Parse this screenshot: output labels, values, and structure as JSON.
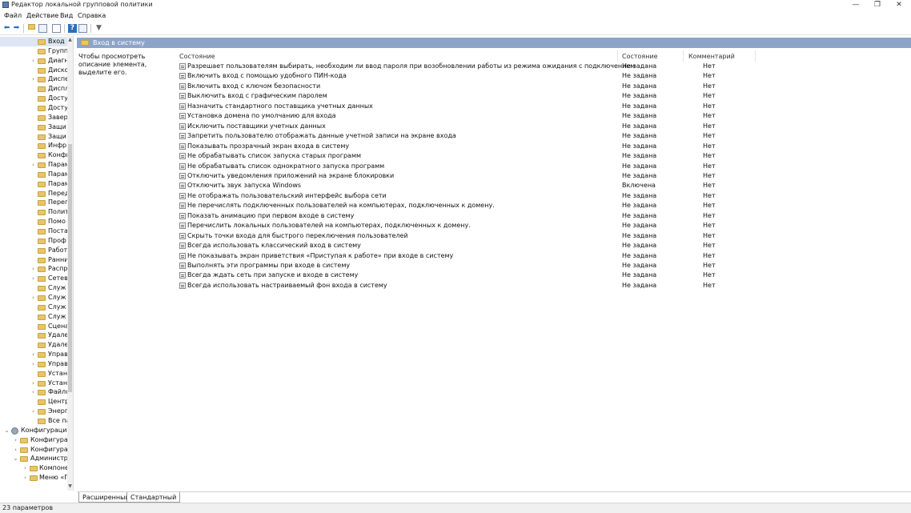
{
  "window": {
    "title": "Редактор локальной групповой политики",
    "controls": {
      "minimize": "—",
      "maximize": "❐",
      "close": "✕"
    }
  },
  "menu": [
    "Файл",
    "Действие",
    "Вид",
    "Справка"
  ],
  "tree": {
    "items": [
      {
        "label": "Вход в",
        "icon": "folder-icon",
        "selected": true
      },
      {
        "label": "Групп",
        "icon": "folder-icon"
      },
      {
        "label": "Диагн",
        "icon": "folder-icon",
        "expandable": true
      },
      {
        "label": "Диско",
        "icon": "folder-icon"
      },
      {
        "label": "Диспе",
        "icon": "folder-icon",
        "expandable": true
      },
      {
        "label": "Диспл",
        "icon": "folder-icon"
      },
      {
        "label": "Досту",
        "icon": "folder-icon"
      },
      {
        "label": "Досту",
        "icon": "folder-icon"
      },
      {
        "label": "Завер",
        "icon": "folder-icon"
      },
      {
        "label": "Защи",
        "icon": "folder-icon"
      },
      {
        "label": "Защи",
        "icon": "folder-icon"
      },
      {
        "label": "Инфр",
        "icon": "folder-icon"
      },
      {
        "label": "Конфи",
        "icon": "folder-icon"
      },
      {
        "label": "Парам",
        "icon": "folder-icon",
        "expandable": true
      },
      {
        "label": "Парам",
        "icon": "folder-icon"
      },
      {
        "label": "Парам",
        "icon": "folder-icon"
      },
      {
        "label": "Перед",
        "icon": "folder-icon"
      },
      {
        "label": "Переп",
        "icon": "folder-icon"
      },
      {
        "label": "Полит",
        "icon": "folder-icon"
      },
      {
        "label": "Помо",
        "icon": "folder-icon"
      },
      {
        "label": "Поста",
        "icon": "folder-icon"
      },
      {
        "label": "Проф",
        "icon": "folder-icon"
      },
      {
        "label": "Работ",
        "icon": "folder-icon"
      },
      {
        "label": "Ранни",
        "icon": "folder-icon"
      },
      {
        "label": "Распр",
        "icon": "folder-icon",
        "expandable": true
      },
      {
        "label": "Сетев",
        "icon": "folder-icon",
        "expandable": true
      },
      {
        "label": "Служ",
        "icon": "folder-icon"
      },
      {
        "label": "Служ",
        "icon": "folder-icon",
        "expandable": true
      },
      {
        "label": "Служ",
        "icon": "folder-icon"
      },
      {
        "label": "Служ",
        "icon": "folder-icon"
      },
      {
        "label": "Сцена",
        "icon": "folder-icon"
      },
      {
        "label": "Удале",
        "icon": "folder-icon"
      },
      {
        "label": "Удале",
        "icon": "folder-icon"
      },
      {
        "label": "Управ",
        "icon": "folder-icon",
        "expandable": true
      },
      {
        "label": "Управ",
        "icon": "folder-icon",
        "expandable": true
      },
      {
        "label": "Устан",
        "icon": "folder-icon"
      },
      {
        "label": "Устан",
        "icon": "folder-icon",
        "expandable": true
      },
      {
        "label": "Файлс",
        "icon": "folder-icon",
        "expandable": true
      },
      {
        "label": "Центр",
        "icon": "folder-icon"
      },
      {
        "label": "Энерг",
        "icon": "folder-icon",
        "expandable": true
      },
      {
        "label": "Все пара",
        "icon": "folder-icon"
      },
      {
        "label": "Конфигурация п",
        "icon": "gear-icon",
        "expanded": true
      },
      {
        "label": "Конфигурац",
        "icon": "folder-icon",
        "expandable": true
      },
      {
        "label": "Конфигурац",
        "icon": "folder-icon",
        "expandable": true
      },
      {
        "label": "Администрат",
        "icon": "folder-icon",
        "expanded": true
      },
      {
        "label": "Компоне",
        "icon": "folder-icon",
        "expandable": true
      },
      {
        "label": "Меню «Г",
        "icon": "folder-icon",
        "expandable": true
      }
    ]
  },
  "header": {
    "title": "Вход в систему"
  },
  "description": "Чтобы просмотреть описание элемента, выделите его.",
  "columns": {
    "name": "Состояние",
    "state": "Состояние",
    "comment": "Комментарий"
  },
  "policies": [
    {
      "name": "Разрешает пользователям выбирать, необходим ли ввод пароля при возобновлении работы из режима ожидания с подключением",
      "state": "Не задана",
      "comment": "Нет"
    },
    {
      "name": "Включить вход с помощью удобного ПИН-кода",
      "state": "Не задана",
      "comment": "Нет"
    },
    {
      "name": "Включить вход с ключом безопасности",
      "state": "Не задана",
      "comment": "Нет"
    },
    {
      "name": "Выключить вход с графическим паролем",
      "state": "Не задана",
      "comment": "Нет"
    },
    {
      "name": "Назначить стандартного поставщика учетных данных",
      "state": "Не задана",
      "comment": "Нет"
    },
    {
      "name": "Установка домена по умолчанию для входа",
      "state": "Не задана",
      "comment": "Нет"
    },
    {
      "name": "Исключить поставщики учетных данных",
      "state": "Не задана",
      "comment": "Нет"
    },
    {
      "name": "Запретить пользователю отображать данные учетной записи на экране входа",
      "state": "Не задана",
      "comment": "Нет"
    },
    {
      "name": "Показывать прозрачный экран входа в систему",
      "state": "Не задана",
      "comment": "Нет"
    },
    {
      "name": "Не обрабатывать список запуска старых программ",
      "state": "Не задана",
      "comment": "Нет"
    },
    {
      "name": "Не обрабатывать список однократного запуска программ",
      "state": "Не задана",
      "comment": "Нет"
    },
    {
      "name": "Отключить уведомления приложений на экране блокировки",
      "state": "Не задана",
      "comment": "Нет"
    },
    {
      "name": "Отключить звук запуска Windows",
      "state": "Включена",
      "comment": "Нет"
    },
    {
      "name": "Не отображать пользовательский интерфейс выбора сети",
      "state": "Не задана",
      "comment": "Нет"
    },
    {
      "name": "Не перечислять подключенных пользователей на компьютерах, подключенных к домену.",
      "state": "Не задана",
      "comment": "Нет"
    },
    {
      "name": "Показать анимацию при первом входе в систему",
      "state": "Не задана",
      "comment": "Нет"
    },
    {
      "name": "Перечислить локальных пользователей на компьютерах, подключенных к домену.",
      "state": "Не задана",
      "comment": "Нет"
    },
    {
      "name": "Скрыть точки входа для быстрого переключения пользователей",
      "state": "Не задана",
      "comment": "Нет"
    },
    {
      "name": "Всегда использовать классический вход в систему",
      "state": "Не задана",
      "comment": "Нет"
    },
    {
      "name": "Не показывать экран приветствия «Приступая к работе» при входе в систему",
      "state": "Не задана",
      "comment": "Нет"
    },
    {
      "name": "Выполнять эти программы при входе в систему",
      "state": "Не задана",
      "comment": "Нет"
    },
    {
      "name": "Всегда ждать сеть при запуске и входе в систему",
      "state": "Не задана",
      "comment": "Нет"
    },
    {
      "name": "Всегда использовать настраиваемый фон входа в систему",
      "state": "Не задана",
      "comment": "Нет"
    }
  ],
  "tabs": [
    "Расширенный",
    "Стандартный"
  ],
  "status": "23 параметров"
}
